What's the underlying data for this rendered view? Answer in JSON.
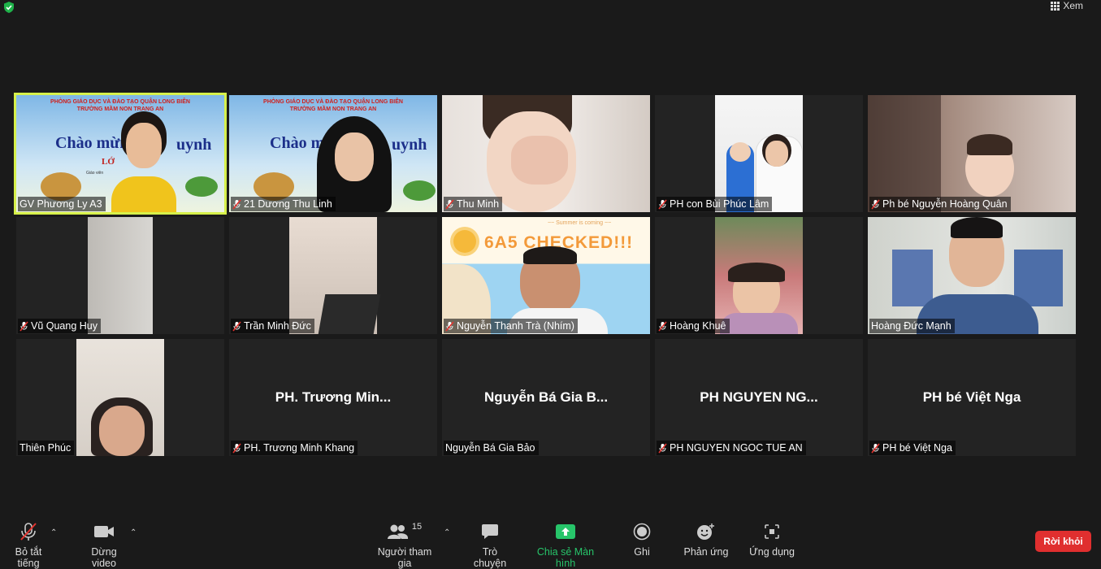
{
  "header": {
    "view_label": "Xem"
  },
  "tiles": [
    {
      "name": "GV Phương Ly A3",
      "muted": false,
      "big": ""
    },
    {
      "name": "21 Dương Thu Linh",
      "muted": true,
      "big": ""
    },
    {
      "name": "Thu Minh",
      "muted": true,
      "big": ""
    },
    {
      "name": "PH con Bùi Phúc Lâm",
      "muted": true,
      "big": ""
    },
    {
      "name": "Ph bé Nguyễn Hoàng Quân",
      "muted": true,
      "big": ""
    },
    {
      "name": "Vũ Quang Huy",
      "muted": true,
      "big": ""
    },
    {
      "name": "Trần Minh Đức",
      "muted": true,
      "big": ""
    },
    {
      "name": "Nguyễn Thanh Trà (Nhím)",
      "muted": true,
      "big": ""
    },
    {
      "name": "Hoàng Khuê",
      "muted": true,
      "big": ""
    },
    {
      "name": "Hoàng Đức Mạnh",
      "muted": false,
      "big": ""
    },
    {
      "name": "Thiên Phúc",
      "muted": false,
      "big": ""
    },
    {
      "name": "PH. Trương Minh Khang",
      "muted": true,
      "big": "PH. Trương Min..."
    },
    {
      "name": "Nguyễn Bá Gia Bảo",
      "muted": false,
      "big": "Nguyễn Bá Gia B..."
    },
    {
      "name": "PH NGUYEN NGOC TUE AN",
      "muted": true,
      "big": "PH NGUYEN NG..."
    },
    {
      "name": "PH bé Việt Nga",
      "muted": true,
      "big": "PH bé Việt Nga"
    }
  ],
  "slide": {
    "line1": "PHÒNG GIÁO DỤC VÀ ĐÀO TẠO QUẬN LONG BIÊN",
    "line2": "TRƯỜNG MẦM NON TRANG AN",
    "title1": "Chào mừng c",
    "title1b": "uynh",
    "title2": "Chào mừn",
    "title2b": "uynh",
    "sub": "LỚ",
    "small": "Giáo viên"
  },
  "checked_bg": {
    "top": "~~ Summer is coming ~~",
    "main": "6A5 CHECKED!!!"
  },
  "toolbar": {
    "mute_label": "Bỏ tắt tiếng",
    "video_label": "Dừng video",
    "participants_label": "Người tham gia",
    "participants_count": "15",
    "chat_label": "Trò chuyện",
    "share_label": "Chia sẻ Màn hình",
    "record_label": "Ghi",
    "reactions_label": "Phản ứng",
    "apps_label": "Ứng dụng",
    "leave_label": "Rời khỏi"
  },
  "colors": {
    "active_border": "#d6f04a",
    "share_green": "#27c56a",
    "leave_red": "#e02f2f"
  }
}
